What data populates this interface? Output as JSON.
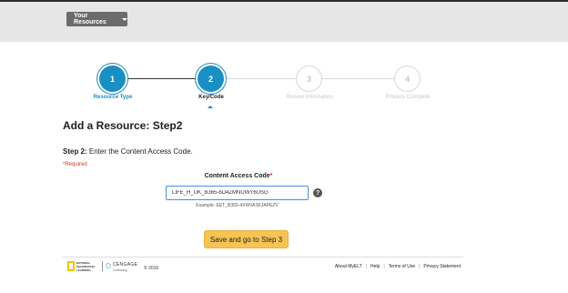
{
  "header": {
    "resources_button": "Your Resources"
  },
  "stepper": {
    "steps": [
      {
        "number": "1",
        "label": "Resource Type",
        "state": "done"
      },
      {
        "number": "2",
        "label": "Key/Code",
        "state": "active"
      },
      {
        "number": "3",
        "label": "Review Information",
        "state": "future"
      },
      {
        "number": "4",
        "label": "Process Complete",
        "state": "future"
      }
    ]
  },
  "main": {
    "title": "Add a Resource: Step2",
    "instruction_prefix": "Step 2:",
    "instruction_text": " Enter the Content Access Code.",
    "required_note": "*Required",
    "field_label": "Content Access Code",
    "field_required_mark": "*",
    "input_value": "LIFE_H_UK_B365-6D4ZMNUWY6USG",
    "example": "Example: EET_B365-4XWVASFJAPEZV",
    "submit_button": "Save and go to Step 3"
  },
  "footer": {
    "ng_logo_text": "NATIONAL GEOGRAPHIC LEARNING",
    "cengage_text": "CENGAGE",
    "cengage_sub": "Learning",
    "copyright": "© 2016",
    "links": [
      "About MyELT",
      "Help",
      "Terms of Use",
      "Privacy Statement"
    ]
  },
  "colors": {
    "accent": "#1a8fc4",
    "button": "#f6c355",
    "required": "#d0342c"
  }
}
